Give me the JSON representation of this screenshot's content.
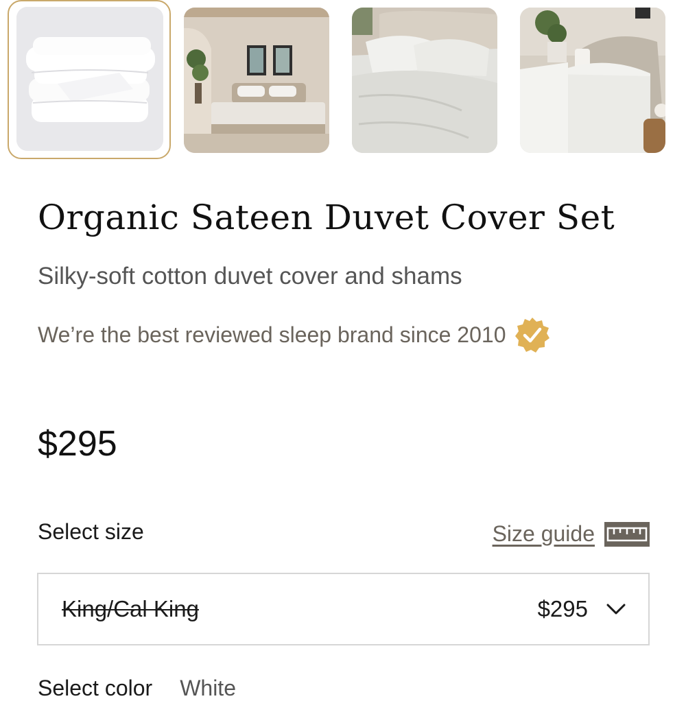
{
  "gallery": {
    "thumbnails": [
      {
        "alt": "duvet-stack",
        "selected": true
      },
      {
        "alt": "bedroom-wide",
        "selected": false
      },
      {
        "alt": "bed-closeup",
        "selected": false
      },
      {
        "alt": "bed-side-view",
        "selected": false
      }
    ],
    "accent_color": "#c9a86a"
  },
  "product": {
    "title": "Organic Sateen Duvet Cover Set",
    "subtitle": "Silky-soft cotton duvet cover and shams",
    "trust_text": "We’re the best reviewed sleep brand since 2010",
    "trust_icon": "verified-badge-icon",
    "badge_color": "#e0b155",
    "price": "$295"
  },
  "size_selector": {
    "label": "Select size",
    "guide_label": "Size guide",
    "guide_icon": "ruler-icon",
    "selected_value": "King/Cal King",
    "selected_price": "$295",
    "dropdown_icon": "chevron-down-icon"
  },
  "color_selector": {
    "label": "Select color",
    "value": "White"
  }
}
